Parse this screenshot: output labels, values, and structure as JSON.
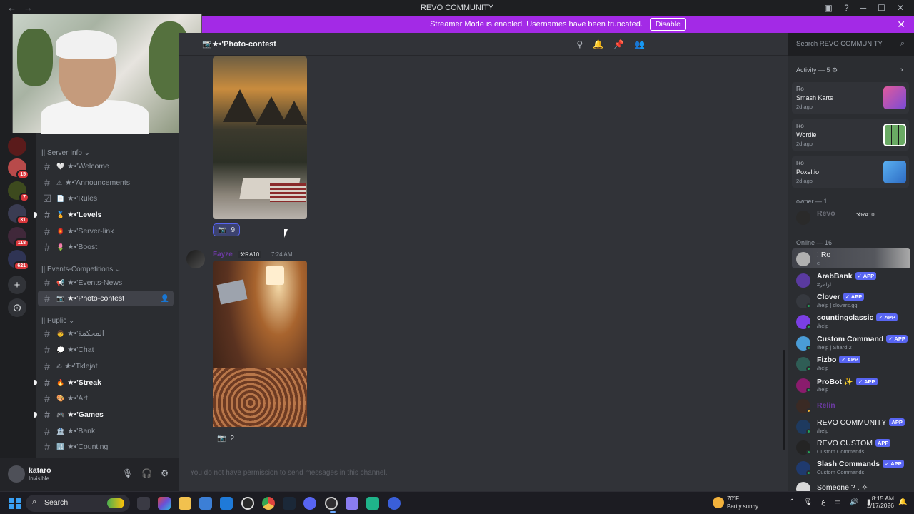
{
  "window": {
    "title": "REVO COMMUNITY",
    "back": "←",
    "forward": "→",
    "inbox_icon": "inbox-icon",
    "help_icon": "help-icon",
    "minimize": "─",
    "maximize": "☐",
    "close": "✕"
  },
  "banner": {
    "text": "Streamer Mode is enabled. Usernames have been truncated.",
    "button": "Disable",
    "close": "✕",
    "color": "#a32ae6"
  },
  "server_badges": [
    "15",
    "7",
    "31",
    "118",
    "621"
  ],
  "channel_list": {
    "categories": [
      {
        "label": "|| Server Info ⌄"
      },
      {
        "label": "|| Events-Competitions ⌄"
      },
      {
        "label": "|| Puplic ⌄"
      }
    ],
    "channels": [
      {
        "emoji": "🤍",
        "label": "★•'Welcome"
      },
      {
        "emoji": "⚠",
        "label": "★•'Announcements"
      },
      {
        "emoji": "📄",
        "label": "★•'Rules"
      },
      {
        "emoji": "🏅",
        "label": "★•'Levels"
      },
      {
        "emoji": "🏮",
        "label": "★•'Server-link"
      },
      {
        "emoji": "🌷",
        "label": "★•'Boost"
      },
      {
        "emoji": "📢",
        "label": "★•'Events-News"
      },
      {
        "emoji": "📷",
        "label": "★•'Photo-contest"
      },
      {
        "emoji": "👨",
        "label": "★•'المحكمة"
      },
      {
        "emoji": "💭",
        "label": "★•'Chat"
      },
      {
        "emoji": "✍",
        "label": "★•'Tklejat"
      },
      {
        "emoji": "🔥",
        "label": "★•'Streak"
      },
      {
        "emoji": "🎨",
        "label": "★•'Art"
      },
      {
        "emoji": "🎮",
        "label": "★•'Games"
      },
      {
        "emoji": "🏦",
        "label": "★•'Bank"
      },
      {
        "emoji": "🔢",
        "label": "★•'Counting"
      }
    ]
  },
  "user": {
    "name": "kataro",
    "status": "Invisible",
    "mic": "🎙",
    "headset": "🎧",
    "settings": "⚙"
  },
  "header": {
    "channel": "📷★•'Photo-contest",
    "search_placeholder": "Search REVO COMMUNITY"
  },
  "messages": {
    "first_reaction_count": "9",
    "author_tag": "⚒RA10",
    "author_name": "Fayze",
    "time": "7:24 AM",
    "second_reaction_count": "2"
  },
  "composer": {
    "placeholder": "You do not have permission to send messages in this channel."
  },
  "activity": {
    "header": "Activity — 5 ⚙",
    "cards": [
      {
        "who": "Ro",
        "game": "Smash Karts",
        "ago": "2d ago"
      },
      {
        "who": "Ro",
        "game": "Wordle",
        "ago": "2d ago"
      },
      {
        "who": "Ro",
        "game": "Poxel.io",
        "ago": "2d ago"
      }
    ]
  },
  "members": {
    "owner_header": "owner — 1",
    "owner": {
      "name": "Revo",
      "tag": "⚒RA10"
    },
    "online_header": "Online — 16",
    "list": [
      {
        "name": "! Ro",
        "sub": "e"
      },
      {
        "name": "ArabBank",
        "app": "✓ APP",
        "sub": "#اوامر"
      },
      {
        "name": "Clover",
        "app": "✓ APP",
        "sub": "/help | clovers.gg"
      },
      {
        "name": "countingclassic",
        "app": "✓ APP",
        "sub": "/help"
      },
      {
        "name": "Custom Command",
        "app": "✓ APP",
        "sub": "!help | Shard 2"
      },
      {
        "name": "Fizbo",
        "app": "✓ APP",
        "sub": "/help"
      },
      {
        "name": "ProBot ✨",
        "app": "✓ APP",
        "sub": "/help"
      },
      {
        "name": "Relin",
        "sub": ""
      },
      {
        "name": "REVO COMMUNITY",
        "app": "APP",
        "sub": "/help"
      },
      {
        "name": "REVO CUSTOM",
        "app": "APP",
        "sub": "Custom Commands"
      },
      {
        "name": "Slash Commands",
        "app": "✓ APP",
        "sub": "Custom Commands"
      },
      {
        "name": "Someone ? . ✧",
        "sub": ""
      }
    ]
  },
  "taskbar": {
    "search": "Search",
    "weather_temp": "70°F",
    "weather_desc": "Partly sunny",
    "time": "8:15 AM",
    "date": "2/17/2026",
    "tray_lang": "ع"
  }
}
